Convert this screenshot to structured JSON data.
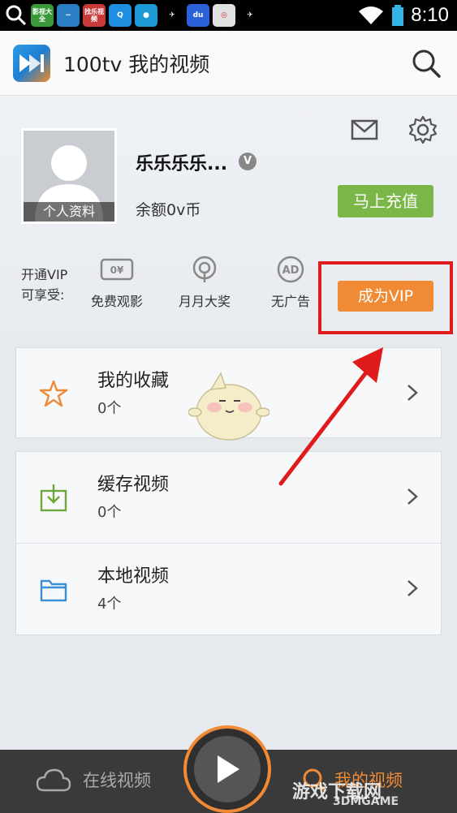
{
  "status_bar": {
    "time": "8:10",
    "app_icons": [
      "影视大全",
      "",
      "找乐视频",
      "",
      "",
      "",
      "",
      "",
      ""
    ]
  },
  "app_bar": {
    "title": "100tv 我的视频"
  },
  "profile": {
    "avatar_label": "个人资料",
    "username": "乐乐乐乐...",
    "badge": "V",
    "balance": "余额0v币",
    "recharge_label": "马上充值"
  },
  "vip": {
    "intro_line1": "开通VIP",
    "intro_line2": "可享受:",
    "perks": [
      {
        "label": "免费观影",
        "icon": "ticket-icon"
      },
      {
        "label": "月月大奖",
        "icon": "prize-icon"
      },
      {
        "label": "无广告",
        "icon": "no-ads-icon"
      }
    ],
    "become_vip_label": "成为VIP"
  },
  "lists": {
    "favorites": {
      "title": "我的收藏",
      "count": "0个"
    },
    "cached": {
      "title": "缓存视频",
      "count": "0个"
    },
    "local": {
      "title": "本地视频",
      "count": "4个"
    }
  },
  "bottom_nav": {
    "online_label": "在线视频",
    "mine_label": "我的视频"
  },
  "watermark": {
    "line1": "游戏下载网",
    "line2": "3DMGAME"
  },
  "colors": {
    "accent_orange": "#f08a34",
    "accent_green": "#7ab648",
    "highlight_red": "#e01b1b"
  }
}
